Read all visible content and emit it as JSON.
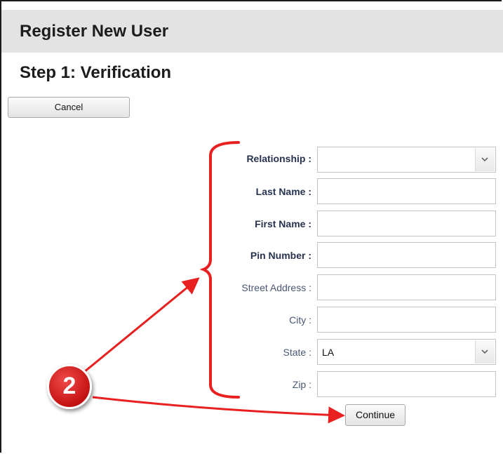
{
  "header": {
    "title": "Register New User",
    "step_title": "Step 1: Verification"
  },
  "buttons": {
    "cancel": "Cancel",
    "continue": "Continue"
  },
  "form": {
    "relationship": {
      "label": "Relationship :",
      "value": ""
    },
    "last_name": {
      "label": "Last Name :",
      "value": ""
    },
    "first_name": {
      "label": "First Name :",
      "value": ""
    },
    "pin_number": {
      "label": "Pin Number :",
      "value": ""
    },
    "street_address": {
      "label": "Street Address :",
      "value": ""
    },
    "city": {
      "label": "City :",
      "value": ""
    },
    "state": {
      "label": "State :",
      "value": "LA"
    },
    "zip": {
      "label": "Zip :",
      "value": ""
    }
  },
  "annotation": {
    "badge_number": "2",
    "color": "#e8201f"
  }
}
